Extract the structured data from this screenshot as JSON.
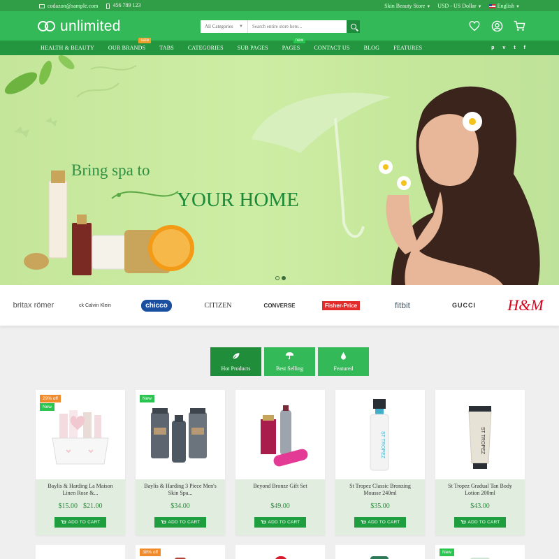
{
  "topbar": {
    "email": "codazon@sample.com",
    "phone": "456 789 123",
    "store": "Skin Beauty Store",
    "currency": "USD - US Dollar",
    "language": "English"
  },
  "header": {
    "logo": "unlimited",
    "search_category": "All Categories",
    "search_placeholder": "Search entire store here..."
  },
  "nav": {
    "items": [
      {
        "label": "HEALTH & BEAUTY",
        "badge": ""
      },
      {
        "label": "OUR BRANDS",
        "badge": "sale"
      },
      {
        "label": "TABS",
        "badge": ""
      },
      {
        "label": "CATEGORIES",
        "badge": ""
      },
      {
        "label": "SUB PAGES",
        "badge": ""
      },
      {
        "label": "PAGES",
        "badge": "new"
      },
      {
        "label": "CONTACT US",
        "badge": ""
      },
      {
        "label": "BLOG",
        "badge": ""
      },
      {
        "label": "FEATURES",
        "badge": ""
      }
    ],
    "socials": [
      "p",
      "v",
      "t",
      "f"
    ]
  },
  "banner": {
    "line1": "Bring spa to",
    "line2": "YOUR HOME"
  },
  "brands": [
    "britax römer",
    "ck Calvin Klein",
    "chicco",
    "CITIZEN",
    "CONVERSE",
    "Fisher-Price",
    "fitbit",
    "GUCCI",
    "H&M"
  ],
  "tabs": [
    {
      "label": "Hot Products",
      "icon": "leaf-icon"
    },
    {
      "label": "Best Selling",
      "icon": "umbrella-icon"
    },
    {
      "label": "Featured",
      "icon": "drop-icon"
    }
  ],
  "products": [
    {
      "name": "Baylis & Harding La Maison Linen Rose &...",
      "price": "$15.00",
      "old_price": "$21.00",
      "discount": "29% off",
      "new": "New"
    },
    {
      "name": "Baylis & Harding 3 Piece Men's Skin Spa...",
      "price": "$34.00",
      "old_price": "",
      "discount": "",
      "new": "New"
    },
    {
      "name": "Beyond Bronze Gift Set",
      "price": "$49.00",
      "old_price": "",
      "discount": "",
      "new": ""
    },
    {
      "name": "St Tropez Classic Bronzing Mousse 240ml",
      "price": "$35.00",
      "old_price": "",
      "discount": "",
      "new": ""
    },
    {
      "name": "St Tropez Gradual Tan Body Lotion 200ml",
      "price": "$43.00",
      "old_price": "",
      "discount": "",
      "new": ""
    }
  ],
  "add_to_cart": "ADD TO CART",
  "row2_badges": {
    "discount": "38% off",
    "new": "New"
  },
  "colors": {
    "primary": "#33b957",
    "dark": "#23963f",
    "topbar": "#2f9e46",
    "price": "#2a8a3c"
  }
}
